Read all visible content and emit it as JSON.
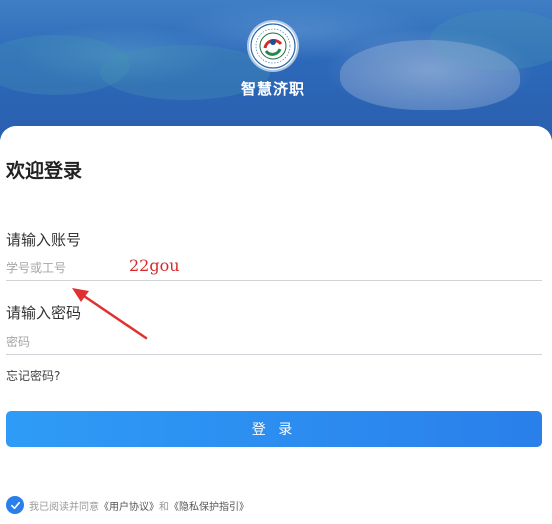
{
  "header": {
    "app_title": "智慧济职",
    "logo_icon": "college-emblem-icon"
  },
  "login": {
    "welcome_title": "欢迎登录",
    "account_label": "请输入账号",
    "account_placeholder": "学号或工号",
    "password_label": "请输入密码",
    "password_placeholder": "密码",
    "forgot_password": "忘记密码?",
    "login_button": "登 录"
  },
  "agreement": {
    "checked": true,
    "prefix": "我已阅读并同意",
    "user_agreement": "《用户协议》",
    "conjunction": "和",
    "privacy_guide": "《隐私保护指引》"
  },
  "annotation": {
    "text": "22gou",
    "color": "#d62a2a"
  },
  "colors": {
    "primary": "#2a7fea",
    "banner": "#2c68b9"
  }
}
